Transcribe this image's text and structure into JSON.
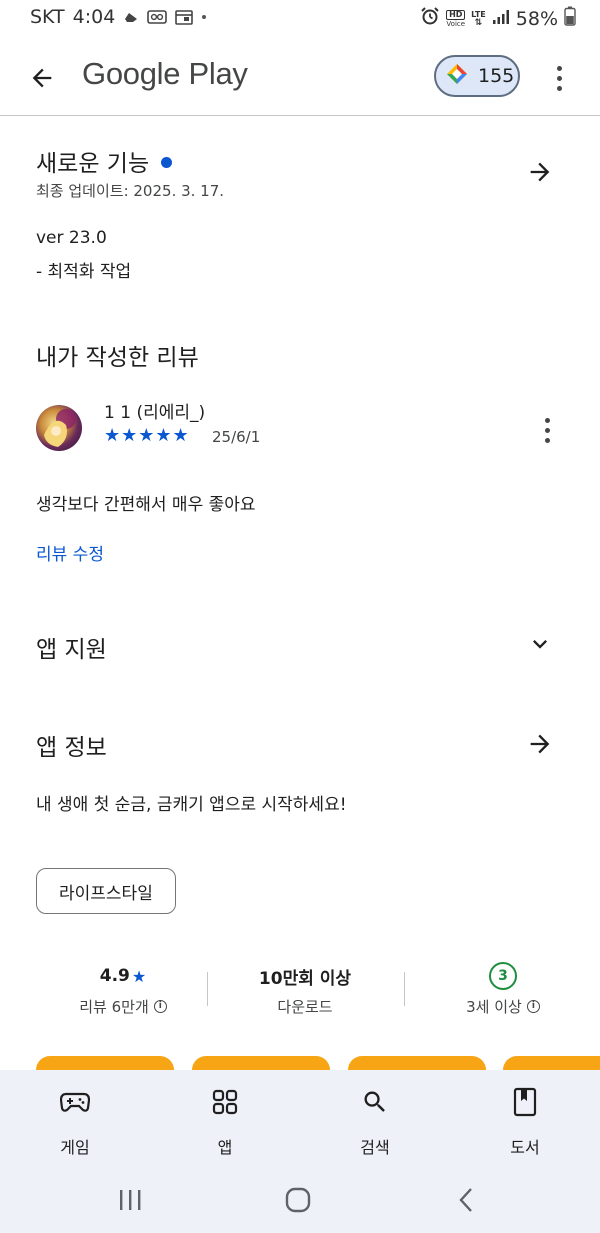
{
  "status_bar": {
    "carrier": "SKT",
    "time": "4:04",
    "hd_voice_top": "HD",
    "hd_voice_bottom": "Voice",
    "network": "LTE",
    "battery": "58%"
  },
  "app_bar": {
    "title": "Google Play",
    "points": "155"
  },
  "whats_new": {
    "title": "새로운 기능",
    "updated": "최종 업데이트: 2025. 3. 17.",
    "version": "ver 23.0",
    "note": "- 최적화 작업"
  },
  "my_review": {
    "title": "내가 작성한 리뷰",
    "reviewer": "1 1 (리에리_)",
    "stars": "★★★★★",
    "rating": 5,
    "date": "25/6/1",
    "text": "생각보다 간편해서 매우 좋아요",
    "edit_label": "리뷰 수정"
  },
  "app_support": {
    "title": "앱 지원"
  },
  "app_info": {
    "title": "앱 정보",
    "description": "내 생애 첫 순금, 금캐기 앱으로 시작하세요!",
    "category_chip": "라이프스타일"
  },
  "stats": {
    "rating_value": "4.9",
    "rating_star": "★",
    "rating_label": "리뷰 6만개",
    "downloads_value": "10만회 이상",
    "downloads_label": "다운로드",
    "age_badge": "3",
    "age_label": "3세 이상"
  },
  "bottom_nav": {
    "items": [
      {
        "label": "게임",
        "icon": "gamepad-icon"
      },
      {
        "label": "앱",
        "icon": "apps-grid-icon"
      },
      {
        "label": "검색",
        "icon": "search-icon"
      },
      {
        "label": "도서",
        "icon": "book-icon"
      }
    ]
  },
  "colors": {
    "accent": "#0b57d0",
    "age_green": "#1e8e3e",
    "card_orange": "#f7a515",
    "nav_bg": "#eef1f8"
  }
}
